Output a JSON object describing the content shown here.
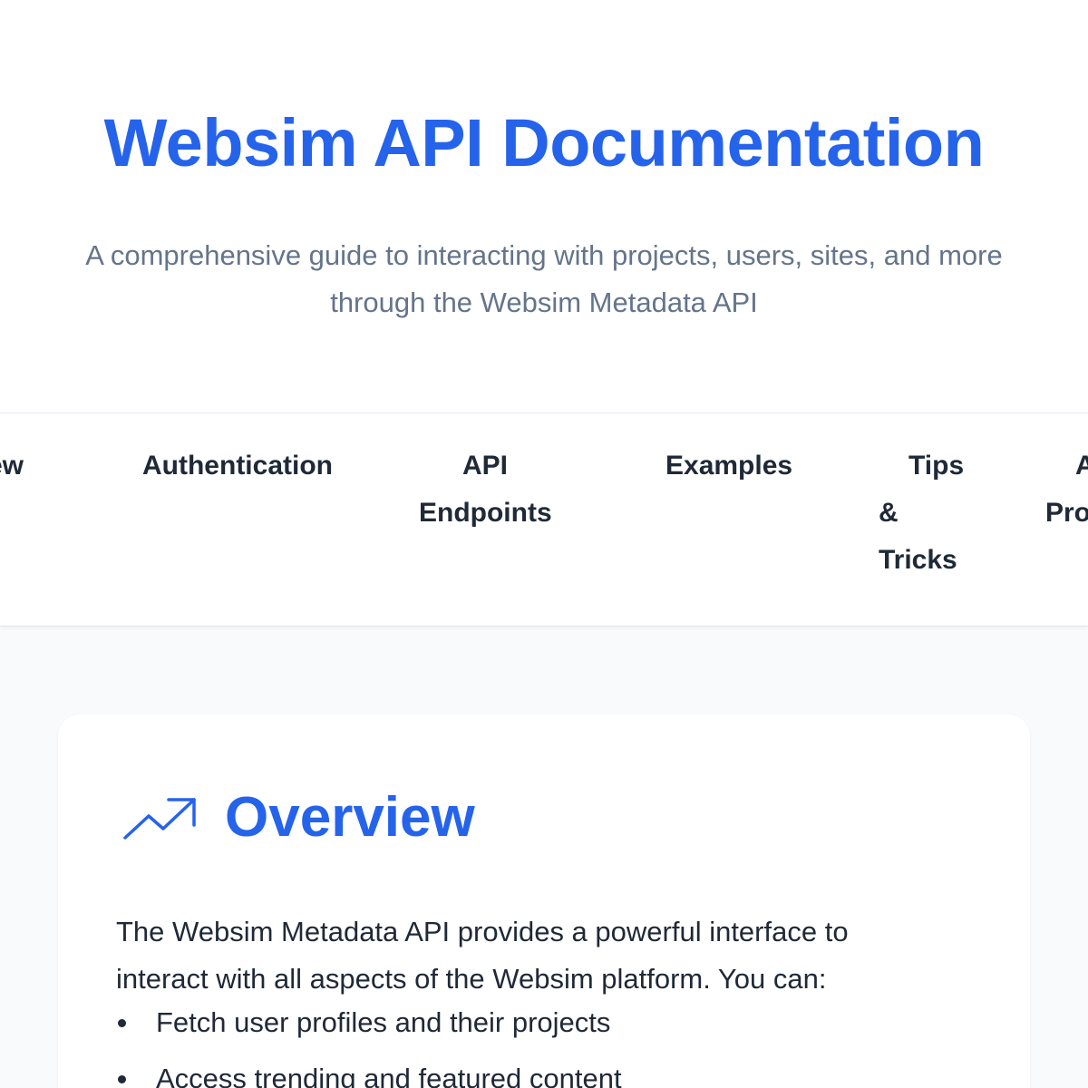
{
  "header": {
    "title": "Websim API Documentation",
    "subtitle_line1": "A comprehensive guide to interacting with projects, users, sites, and more",
    "subtitle_line2": "through the Websim Metadata API"
  },
  "nav": {
    "items": [
      {
        "lines": [
          "ew"
        ]
      },
      {
        "lines": [
          "Authentication"
        ]
      },
      {
        "lines": [
          "API",
          "Endpoints"
        ]
      },
      {
        "lines": [
          "Examples"
        ]
      },
      {
        "lines": [
          "Tips",
          "&",
          "Tricks"
        ]
      },
      {
        "lines": [
          "A",
          "Pro"
        ]
      }
    ]
  },
  "overview": {
    "icon": "trending-up-icon",
    "title": "Overview",
    "intro_line1": "The Websim Metadata API provides a powerful interface to",
    "intro_line2": "interact with all aspects of the Websim platform. You can:",
    "features": [
      "Fetch user profiles and their projects",
      "Access trending and featured content"
    ]
  },
  "colors": {
    "accent": "#2563eb",
    "subtitle": "#64748b",
    "text": "#1f2937",
    "page_background": "#f8fafc"
  }
}
